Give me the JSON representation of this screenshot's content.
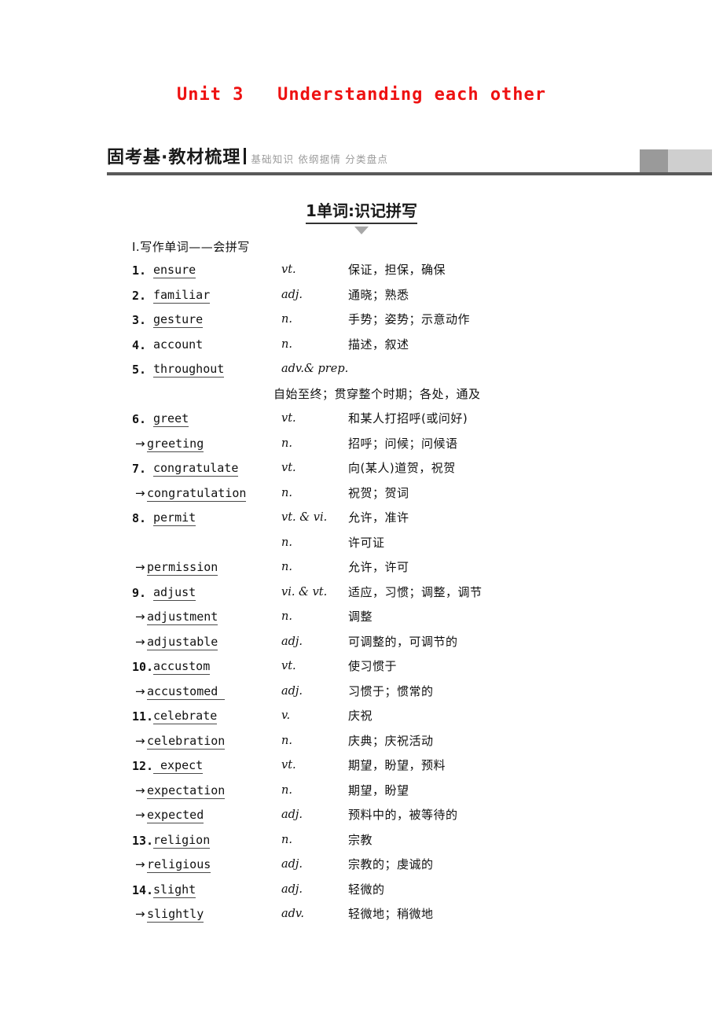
{
  "unit": {
    "title": "Unit 3   Understanding each other",
    "title_color": "#ee1111"
  },
  "banner": {
    "main": "固考基·教材梳理",
    "sub": "基础知识 依纲据情 分类盘点",
    "rule_color": "#595959",
    "block_dark": "#9a9a9a",
    "block_light": "#cfcfcf"
  },
  "section": {
    "heading": "1单词:识记拼写",
    "subheading": "Ⅰ.写作单词——会拼写"
  },
  "words": [
    {
      "num": "1.",
      "word": "ensure",
      "underline": true,
      "derived": false,
      "pos": "vt.",
      "meaning": "保证，担保，确保"
    },
    {
      "num": "2.",
      "word": "familiar",
      "underline": true,
      "derived": false,
      "pos": "adj.",
      "meaning": "通晓；熟悉"
    },
    {
      "num": "3.",
      "word": "gesture",
      "underline": true,
      "derived": false,
      "pos": "n.",
      "meaning": "手势；姿势；示意动作"
    },
    {
      "num": "4.",
      "word": "account",
      "underline": false,
      "derived": false,
      "pos": "n.",
      "meaning": "描述，叙述"
    },
    {
      "num": "5.",
      "word": "throughout",
      "underline": true,
      "derived": false,
      "pos": "adv.& prep.",
      "meaning": ""
    },
    {
      "num": "",
      "word": "",
      "underline": false,
      "derived": false,
      "pos": "",
      "meaning": "自始至终；贯穿整个时期；各处，通及",
      "wrap": true
    },
    {
      "num": "6.",
      "word": "greet",
      "underline": true,
      "derived": false,
      "pos": "vt.",
      "meaning": "和某人打招呼(或问好)"
    },
    {
      "num": "",
      "word": "greeting",
      "underline": true,
      "derived": true,
      "pos": "n.",
      "meaning": "招呼；问候；问候语"
    },
    {
      "num": "7.",
      "word": "congratulate",
      "underline": true,
      "derived": false,
      "pos": "vt.",
      "meaning": "向(某人)道贺，祝贺"
    },
    {
      "num": "",
      "word": "congratulation",
      "underline": true,
      "derived": true,
      "pos": "n.",
      "meaning": "祝贺；贺词"
    },
    {
      "num": "8.",
      "word": "permit",
      "underline": true,
      "derived": false,
      "pos": "vt. & vi.",
      "meaning": "允许，准许"
    },
    {
      "num": "",
      "word": "",
      "underline": false,
      "derived": false,
      "pos": "n.",
      "meaning": "许可证"
    },
    {
      "num": "",
      "word": "permission",
      "underline": true,
      "derived": true,
      "pos": "n.",
      "meaning": "允许，许可"
    },
    {
      "num": "9.",
      "word": "adjust",
      "underline": true,
      "derived": false,
      "pos": "vi. & vt.",
      "meaning": "适应，习惯；调整，调节"
    },
    {
      "num": "",
      "word": "adjustment",
      "underline": true,
      "derived": true,
      "pos": "n.",
      "meaning": "调整"
    },
    {
      "num": "",
      "word": "adjustable",
      "underline": true,
      "derived": true,
      "pos": "adj.",
      "meaning": "可调整的，可调节的"
    },
    {
      "num": "10.",
      "word": "accustom",
      "underline": true,
      "derived": false,
      "pos": "vt.",
      "meaning": "使习惯于"
    },
    {
      "num": "",
      "word": "accustomed ",
      "underline": true,
      "derived": true,
      "pos": "adj.",
      "meaning": "习惯于；惯常的"
    },
    {
      "num": "11.",
      "word": "celebrate",
      "underline": true,
      "derived": false,
      "pos": "v.",
      "meaning": "庆祝"
    },
    {
      "num": "",
      "word": "celebration",
      "underline": true,
      "derived": true,
      "pos": "n.",
      "meaning": "庆典；庆祝活动"
    },
    {
      "num": "12.",
      "word": " expect",
      "underline": true,
      "derived": false,
      "pos": "vt.",
      "meaning": "期望，盼望，预料"
    },
    {
      "num": "",
      "word": "expectation",
      "underline": true,
      "derived": true,
      "pos": "n.",
      "meaning": "期望，盼望"
    },
    {
      "num": "",
      "word": "expected",
      "underline": true,
      "derived": true,
      "pos": "adj.",
      "meaning": "预料中的，被等待的"
    },
    {
      "num": "13.",
      "word": "religion",
      "underline": true,
      "derived": false,
      "pos": "n.",
      "meaning": "宗教"
    },
    {
      "num": "",
      "word": "religious",
      "underline": true,
      "derived": true,
      "pos": "adj.",
      "meaning": "宗教的；虔诚的"
    },
    {
      "num": "14.",
      "word": "slight",
      "underline": true,
      "derived": false,
      "pos": "adj.",
      "meaning": "轻微的"
    },
    {
      "num": "",
      "word": "slightly",
      "underline": true,
      "derived": true,
      "pos": "adv.",
      "meaning": "轻微地；稍微地"
    }
  ],
  "icons": {
    "derived_arrow": "→"
  }
}
